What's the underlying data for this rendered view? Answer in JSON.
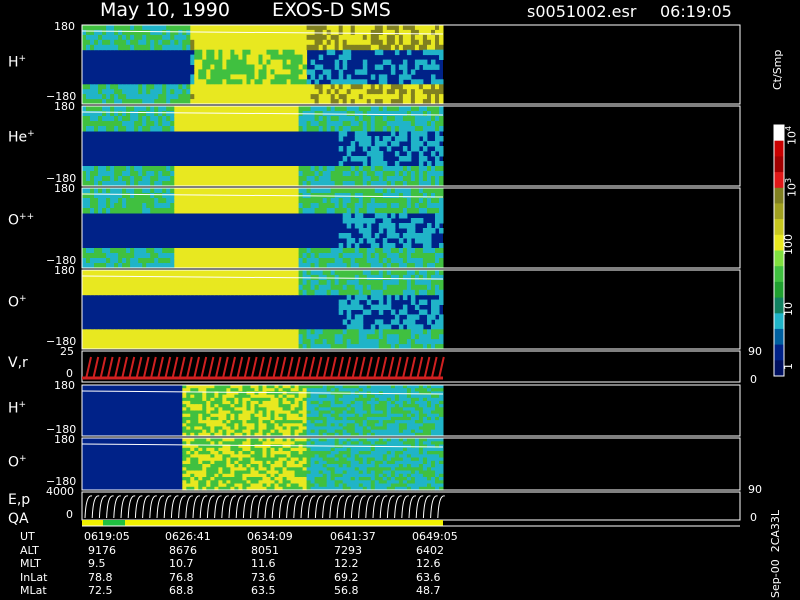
{
  "header": {
    "date": "May 10, 1990",
    "instrument": "EXOS-D SMS",
    "file": "s0051002.esr",
    "time": "06:19:05"
  },
  "colors": {
    "background": "#000000",
    "axis": "#ffffff",
    "low": "#002288",
    "cyan": "#20b4c8",
    "green": "#40c040",
    "yellow": "#e8e820",
    "olive": "#808020",
    "red": "#e00000",
    "velocity": "#d02020",
    "qa_green": "#20c040",
    "qa_yellow": "#f0f000"
  },
  "chart_data": {
    "type": "heatmap",
    "panels": [
      {
        "id": "h-plus-top",
        "label_base": "H",
        "label_sup": "+",
        "ytop": "180",
        "ybottom": "−180",
        "ylim": [
          -180,
          180
        ]
      },
      {
        "id": "he-plus",
        "label_base": "He",
        "label_sup": "+",
        "ytop": "180",
        "ybottom": "−180",
        "ylim": [
          -180,
          180
        ]
      },
      {
        "id": "o-plusplus",
        "label_base": "O",
        "label_sup": "++",
        "ytop": "180",
        "ybottom": "−180",
        "ylim": [
          -180,
          180
        ]
      },
      {
        "id": "o-plus-top",
        "label_base": "O",
        "label_sup": "+",
        "ytop": "180",
        "ybottom": "−180",
        "ylim": [
          -180,
          180
        ]
      },
      {
        "id": "h-plus-low",
        "label_base": "H",
        "label_sup": "+",
        "ytop": "180",
        "ybottom": "−180",
        "ylim": [
          -180,
          180
        ]
      },
      {
        "id": "o-plus-low",
        "label_base": "O",
        "label_sup": "+",
        "ytop": "180",
        "ybottom": "−180",
        "ylim": [
          -180,
          180
        ]
      }
    ],
    "velocity_panel": {
      "label": "V,r",
      "ytop": "25",
      "ybottom": "0",
      "right_top": "90",
      "right_bottom": "0"
    },
    "energy_panel": {
      "label": "E,p",
      "qa_label": "QA",
      "ytop": "4000",
      "ybottom": "0",
      "right_top": "90",
      "right_bottom": "0"
    },
    "colorbar": {
      "unit": "Ct/Smp",
      "ticks": [
        "10",
        "10",
        "10",
        "100",
        "10",
        "1"
      ],
      "tick_sups": [
        "4",
        "3",
        "",
        "",
        "",
        ""
      ],
      "scale": "log",
      "range": [
        1,
        10000
      ]
    },
    "axis_table": {
      "rows": [
        {
          "label": "UT",
          "values": [
            "0619:05",
            "0626:41",
            "0634:09",
            "0641:37",
            "0649:05"
          ]
        },
        {
          "label": "ALT",
          "values": [
            "9176",
            "8676",
            "8051",
            "7293",
            "6402"
          ]
        },
        {
          "label": "MLT",
          "values": [
            "9.5",
            "10.7",
            "11.6",
            "12.2",
            "12.6"
          ]
        },
        {
          "label": "InLat",
          "values": [
            "78.8",
            "76.8",
            "73.6",
            "69.2",
            "63.6"
          ]
        },
        {
          "label": "MLat",
          "values": [
            "72.5",
            "68.8",
            "63.5",
            "56.8",
            "48.7"
          ]
        }
      ]
    },
    "footer_note": "Sep-00  2CA33L"
  }
}
